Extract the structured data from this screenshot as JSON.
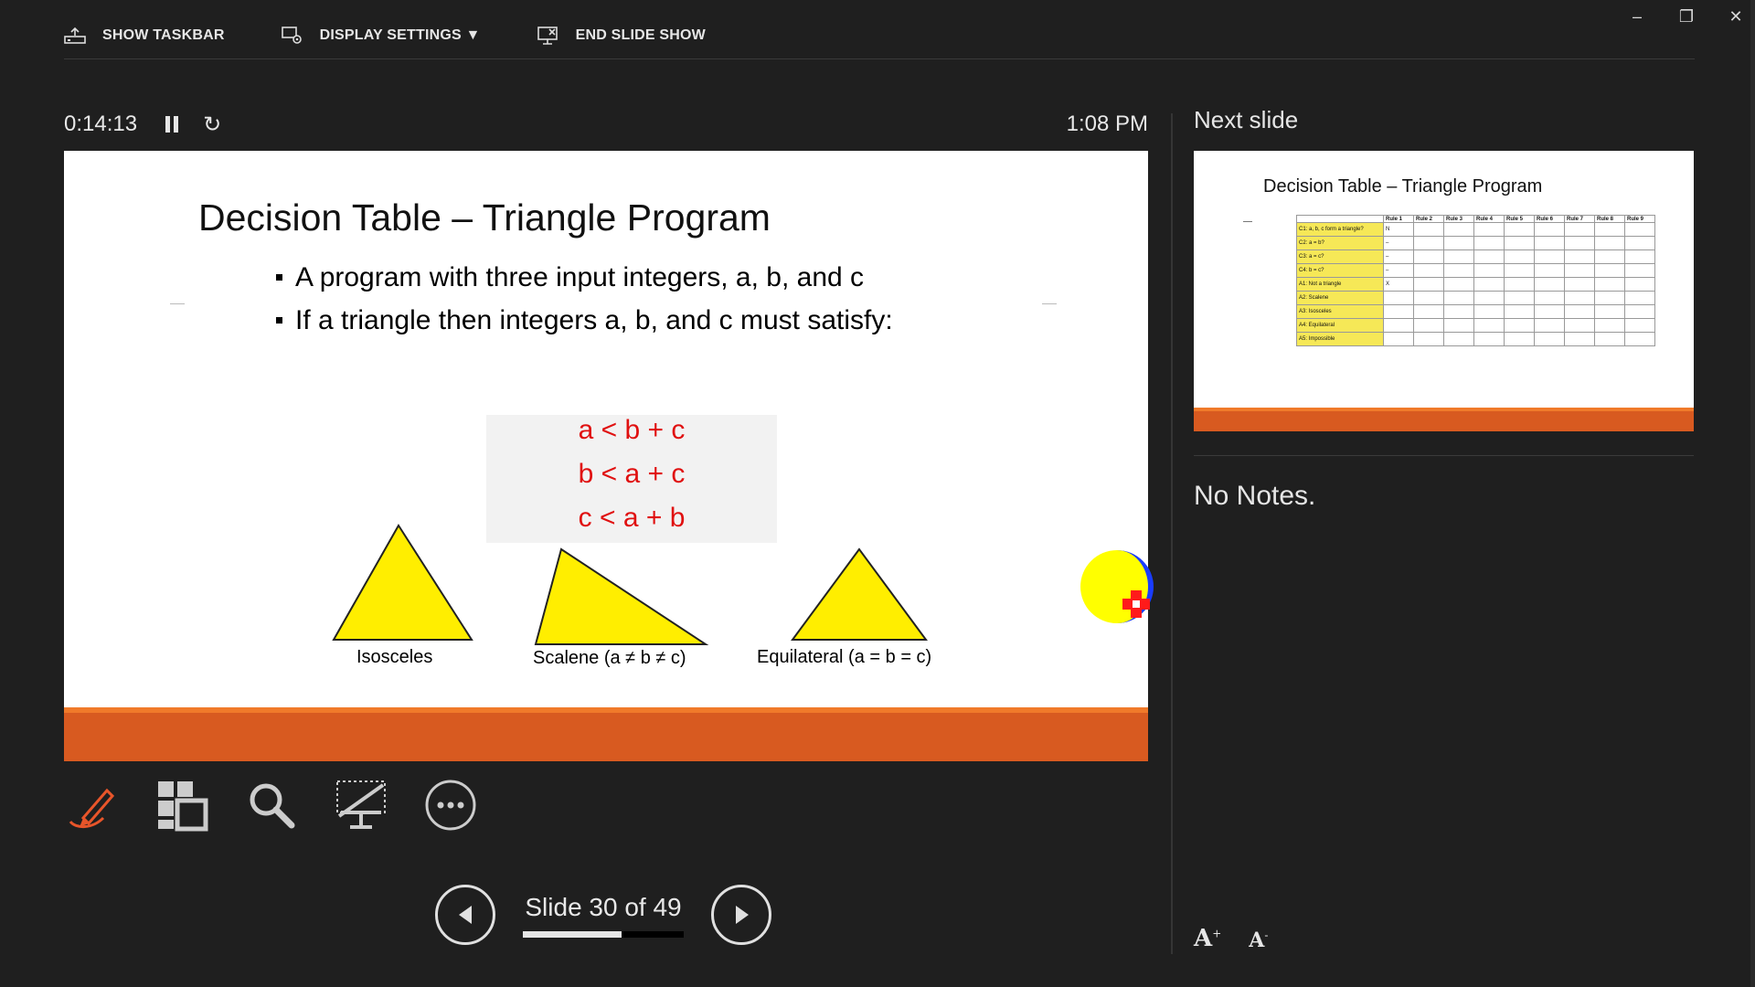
{
  "toolbar": {
    "show_taskbar": "SHOW TASKBAR",
    "display_settings": "DISPLAY SETTINGS ▼",
    "end_slide_show": "END SLIDE SHOW"
  },
  "window_controls": {
    "minimize": "–",
    "restore": "❐",
    "close": "✕"
  },
  "presenter": {
    "elapsed": "0:14:13",
    "clock": "1:08 PM"
  },
  "current_slide": {
    "title": "Decision Table – Triangle Program",
    "bullets": [
      "A program with three input integers, a, b, and c",
      "If a triangle then integers a, b, and c must satisfy:"
    ],
    "equations": [
      "a < b + c",
      "b < a + c",
      "c < a + b"
    ],
    "triangles": [
      {
        "label": "Isosceles"
      },
      {
        "label": "Scalene (a ≠ b ≠ c)"
      },
      {
        "label": "Equilateral (a = b = c)"
      }
    ],
    "accent_color": "#d85a20",
    "triangle_color": "#ffee00"
  },
  "navigation": {
    "slide_text": "Slide 30 of 49",
    "current": 30,
    "total": 49
  },
  "next_slide": {
    "label": "Next slide",
    "title": "Decision Table – Triangle Program",
    "table": {
      "headers": [
        "Rule 1",
        "Rule 2",
        "Rule 3",
        "Rule 4",
        "Rule 5",
        "Rule 6",
        "Rule 7",
        "Rule 8",
        "Rule 9"
      ],
      "rows": [
        {
          "label": "C1: a, b, c form a triangle?",
          "first": "N"
        },
        {
          "label": "C2: a = b?",
          "first": "–"
        },
        {
          "label": "C3: a = c?",
          "first": "–"
        },
        {
          "label": "C4: b = c?",
          "first": "–"
        },
        {
          "label": "A1: Not a triangle",
          "first": "X"
        },
        {
          "label": "A2: Scalene",
          "first": ""
        },
        {
          "label": "A3: Isosceles",
          "first": ""
        },
        {
          "label": "A4: Equilateral",
          "first": ""
        },
        {
          "label": "A5: Impossible",
          "first": ""
        }
      ]
    }
  },
  "notes": {
    "text": "No Notes."
  },
  "font_buttons": {
    "increase": "A",
    "decrease": "A"
  }
}
